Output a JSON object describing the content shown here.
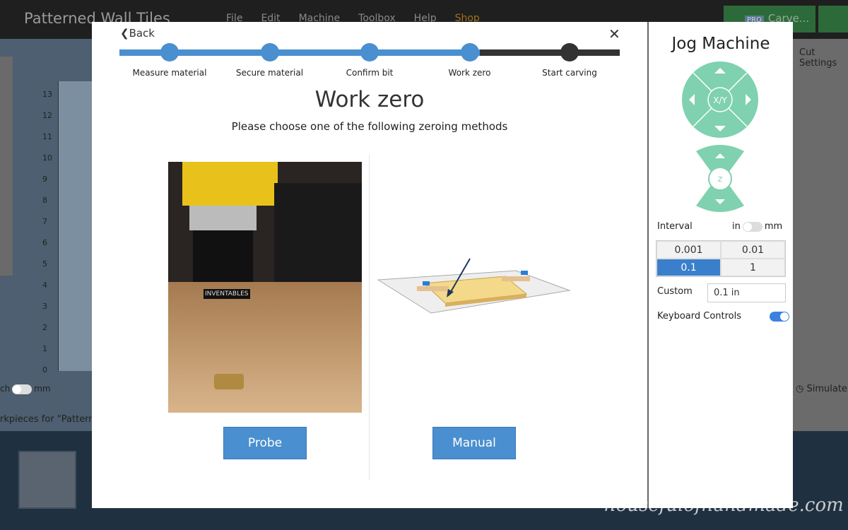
{
  "app": {
    "title": "Patterned Wall Tiles",
    "menu": [
      "File",
      "Edit",
      "Machine",
      "Toolbox",
      "Help",
      "Shop"
    ],
    "carve_label": "Carve...",
    "pro_badge": "PRO",
    "cut_settings": "Cut Settings",
    "simulate": "Simulate",
    "workpieces": "rkpieces for \"Pattern",
    "unit_left": "ch",
    "unit_right": "mm",
    "ruler": [
      "13",
      "12",
      "11",
      "10",
      "9",
      "8",
      "7",
      "6",
      "5",
      "4",
      "3",
      "2",
      "1",
      "0"
    ]
  },
  "wizard": {
    "back": "Back",
    "close": "✕",
    "title": "Work zero",
    "subtitle": "Please choose one of the following zeroing methods",
    "steps": [
      {
        "label": "Measure material",
        "done": true
      },
      {
        "label": "Secure material",
        "done": true
      },
      {
        "label": "Confirm bit",
        "done": true
      },
      {
        "label": "Work zero",
        "done": true
      },
      {
        "label": "Start carving",
        "done": false
      }
    ],
    "progress_percent": 72,
    "probe_label": "Probe",
    "manual_label": "Manual",
    "photo_text": "INVENTABLES"
  },
  "jog": {
    "title": "Jog Machine",
    "xy_label": "X/Y",
    "z_label": "Z",
    "interval_label": "Interval",
    "unit_in": "in",
    "unit_mm": "mm",
    "intervals": [
      "0.001",
      "0.01",
      "0.1",
      "1"
    ],
    "selected_interval": "0.1",
    "custom_label": "Custom",
    "custom_value": "0.1 in",
    "keyboard_label": "Keyboard Controls",
    "keyboard_on": true,
    "pad_color": "#7fd1b0"
  },
  "watermark": "housefulofhandmade.com"
}
